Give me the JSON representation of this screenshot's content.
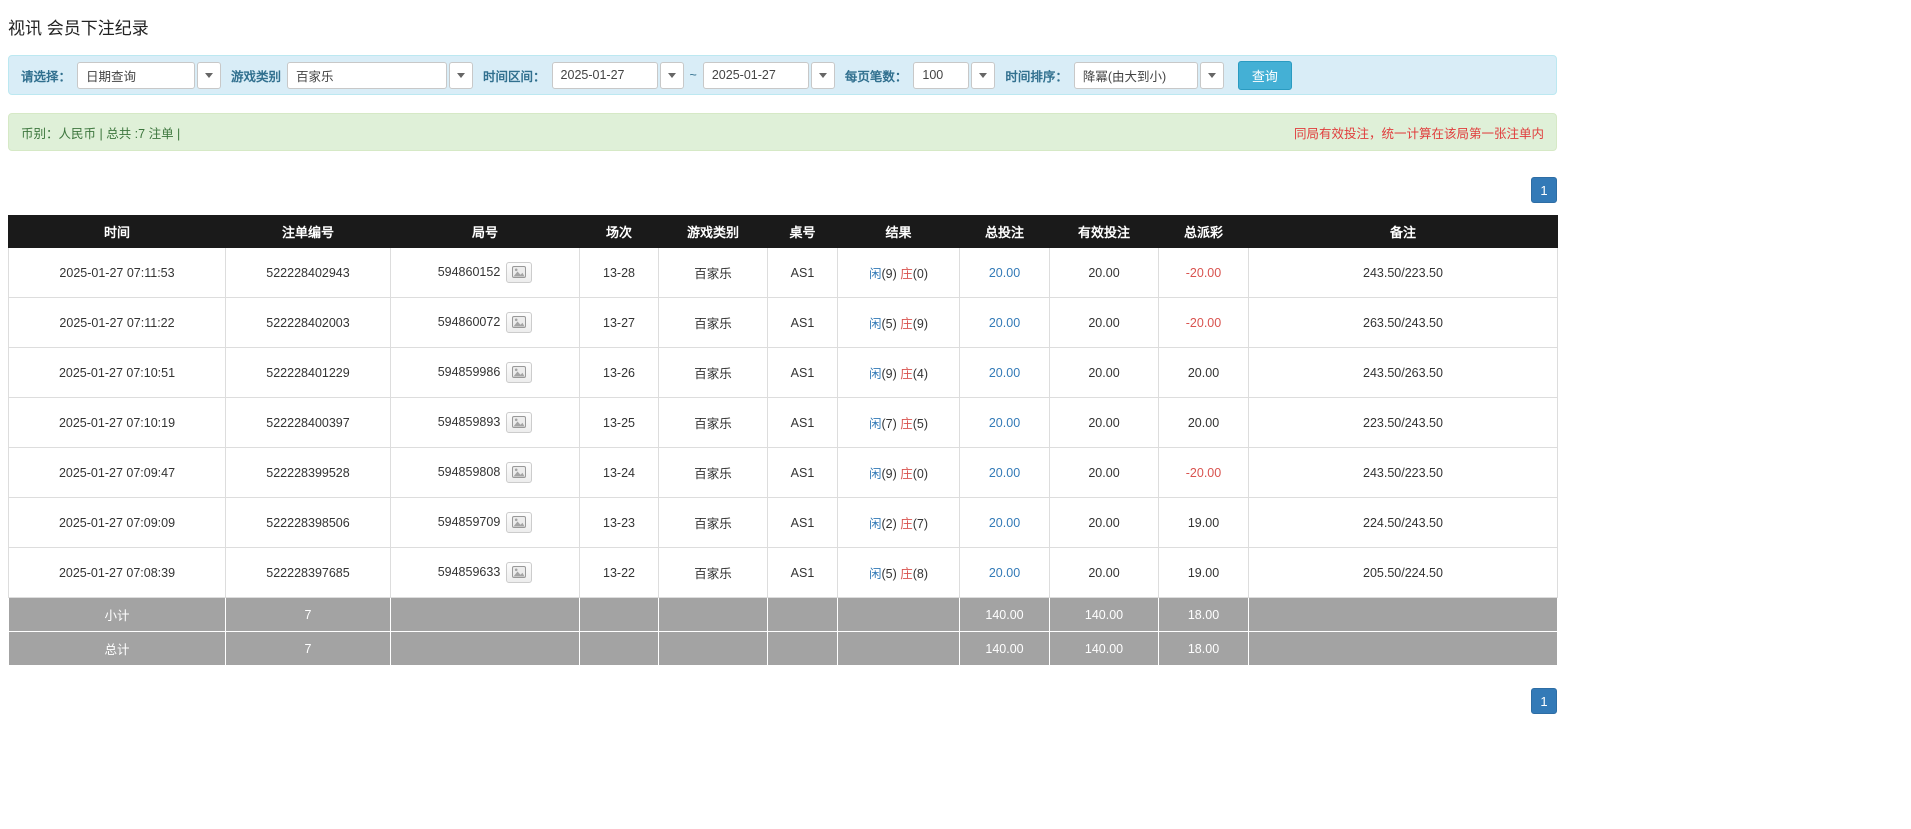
{
  "page": {
    "title": "视讯 会员下注纪录"
  },
  "colors": {
    "filter_bar_bg": "#d9edf7",
    "summary_bar_bg": "#dff0d8",
    "header_bg": "#1a1a1a",
    "footer_row_bg": "#a3a3a3",
    "accent_blue": "#337ab7",
    "negative_red": "#d9534f",
    "notice_red": "#e03c3c",
    "search_button_bg": "#44b0d5"
  },
  "filters": {
    "select_label": "请选择：",
    "select_value": "日期查询",
    "game_label": "游戏类别",
    "game_value": "百家乐",
    "range_label": "时间区间：",
    "date_from": "2025-01-27",
    "range_separator": "~",
    "date_to": "2025-01-27",
    "per_page_label": "每页笔数：",
    "per_page_value": "100",
    "sort_label": "时间排序：",
    "sort_value": "降冪(由大到小)",
    "search_button": "查询"
  },
  "summary": {
    "currency_info": "币别：人民币 | 总共 :7 注单 |",
    "notice": "同局有效投注，统一计算在该局第一张注单内"
  },
  "pagination": {
    "page": "1"
  },
  "table": {
    "headers": [
      "时间",
      "注单编号",
      "局号",
      "场次",
      "游戏类别",
      "桌号",
      "结果",
      "总投注",
      "有效投注",
      "总派彩",
      "备注"
    ],
    "rows": [
      {
        "time": "2025-01-27 07:11:53",
        "bet_id": "522228402943",
        "round": "594860152",
        "session": "13-28",
        "game": "百家乐",
        "table": "AS1",
        "xian": "闲",
        "xian_score": "(9)",
        "zhuang": "庄",
        "zhuang_score": "(0)",
        "total_bet": "20.00",
        "valid_bet": "20.00",
        "payout": "-20.00",
        "note": "243.50/223.50"
      },
      {
        "time": "2025-01-27 07:11:22",
        "bet_id": "522228402003",
        "round": "594860072",
        "session": "13-27",
        "game": "百家乐",
        "table": "AS1",
        "xian": "闲",
        "xian_score": "(5)",
        "zhuang": "庄",
        "zhuang_score": "(9)",
        "total_bet": "20.00",
        "valid_bet": "20.00",
        "payout": "-20.00",
        "note": "263.50/243.50"
      },
      {
        "time": "2025-01-27 07:10:51",
        "bet_id": "522228401229",
        "round": "594859986",
        "session": "13-26",
        "game": "百家乐",
        "table": "AS1",
        "xian": "闲",
        "xian_score": "(9)",
        "zhuang": "庄",
        "zhuang_score": "(4)",
        "total_bet": "20.00",
        "valid_bet": "20.00",
        "payout": "20.00",
        "note": "243.50/263.50"
      },
      {
        "time": "2025-01-27 07:10:19",
        "bet_id": "522228400397",
        "round": "594859893",
        "session": "13-25",
        "game": "百家乐",
        "table": "AS1",
        "xian": "闲",
        "xian_score": "(7)",
        "zhuang": "庄",
        "zhuang_score": "(5)",
        "total_bet": "20.00",
        "valid_bet": "20.00",
        "payout": "20.00",
        "note": "223.50/243.50"
      },
      {
        "time": "2025-01-27 07:09:47",
        "bet_id": "522228399528",
        "round": "594859808",
        "session": "13-24",
        "game": "百家乐",
        "table": "AS1",
        "xian": "闲",
        "xian_score": "(9)",
        "zhuang": "庄",
        "zhuang_score": "(0)",
        "total_bet": "20.00",
        "valid_bet": "20.00",
        "payout": "-20.00",
        "note": "243.50/223.50"
      },
      {
        "time": "2025-01-27 07:09:09",
        "bet_id": "522228398506",
        "round": "594859709",
        "session": "13-23",
        "game": "百家乐",
        "table": "AS1",
        "xian": "闲",
        "xian_score": "(2)",
        "zhuang": "庄",
        "zhuang_score": "(7)",
        "total_bet": "20.00",
        "valid_bet": "20.00",
        "payout": "19.00",
        "note": "224.50/243.50"
      },
      {
        "time": "2025-01-27 07:08:39",
        "bet_id": "522228397685",
        "round": "594859633",
        "session": "13-22",
        "game": "百家乐",
        "table": "AS1",
        "xian": "闲",
        "xian_score": "(5)",
        "zhuang": "庄",
        "zhuang_score": "(8)",
        "total_bet": "20.00",
        "valid_bet": "20.00",
        "payout": "19.00",
        "note": "205.50/224.50"
      }
    ],
    "footer": [
      {
        "label": "小计",
        "count": "7",
        "total_bet": "140.00",
        "valid_bet": "140.00",
        "payout": "18.00",
        "note": ""
      },
      {
        "label": "总计",
        "count": "7",
        "total_bet": "140.00",
        "valid_bet": "140.00",
        "payout": "18.00",
        "note": ""
      }
    ]
  }
}
